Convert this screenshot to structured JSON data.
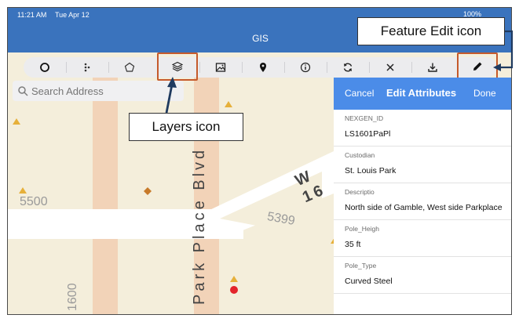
{
  "status": {
    "time": "11:21 AM",
    "date": "Tue Apr 12",
    "battery": "100%"
  },
  "app": {
    "title": "GIS"
  },
  "toolbar": {
    "tools": [
      {
        "name": "circle-tool",
        "icon": "circle-icon"
      },
      {
        "name": "multipoint-tool",
        "icon": "dots-icon"
      },
      {
        "name": "polygon-tool",
        "icon": "pentagon-icon"
      },
      {
        "name": "layers-tool",
        "icon": "layers-icon"
      },
      {
        "name": "image-tool",
        "icon": "image-icon"
      },
      {
        "name": "pin-tool",
        "icon": "location-pin-icon"
      },
      {
        "name": "info-tool",
        "icon": "info-icon"
      },
      {
        "name": "refresh-tool",
        "icon": "refresh-icon"
      },
      {
        "name": "close-tool",
        "icon": "close-icon"
      },
      {
        "name": "download-tool",
        "icon": "download-icon"
      },
      {
        "name": "edit-tool",
        "icon": "pencil-icon"
      }
    ]
  },
  "search": {
    "placeholder": "Search Address"
  },
  "map": {
    "labels": [
      "5500",
      "5399",
      "1600"
    ],
    "streets": [
      "Park Place Blvd",
      "W 16"
    ]
  },
  "panel": {
    "cancel": "Cancel",
    "title": "Edit Attributes",
    "done": "Done",
    "fields": [
      {
        "label": "NEXGEN_ID",
        "value": "LS1601PaPl"
      },
      {
        "label": "Custodian",
        "value": "St. Louis Park"
      },
      {
        "label": "Descriptio",
        "value": "North side of Gamble, West side Parkplace"
      },
      {
        "label": "Pole_Heigh",
        "value": "35 ft"
      },
      {
        "label": "Pole_Type",
        "value": "Curved Steel"
      }
    ]
  },
  "callouts": {
    "feature_edit": "Feature Edit icon",
    "layers": "Layers icon"
  },
  "colors": {
    "header": "#3a73bd",
    "panel_header": "#4b8ce8",
    "highlight": "#c55a2b",
    "map_bg": "#f4eedb",
    "road": "#f2d3b8"
  }
}
